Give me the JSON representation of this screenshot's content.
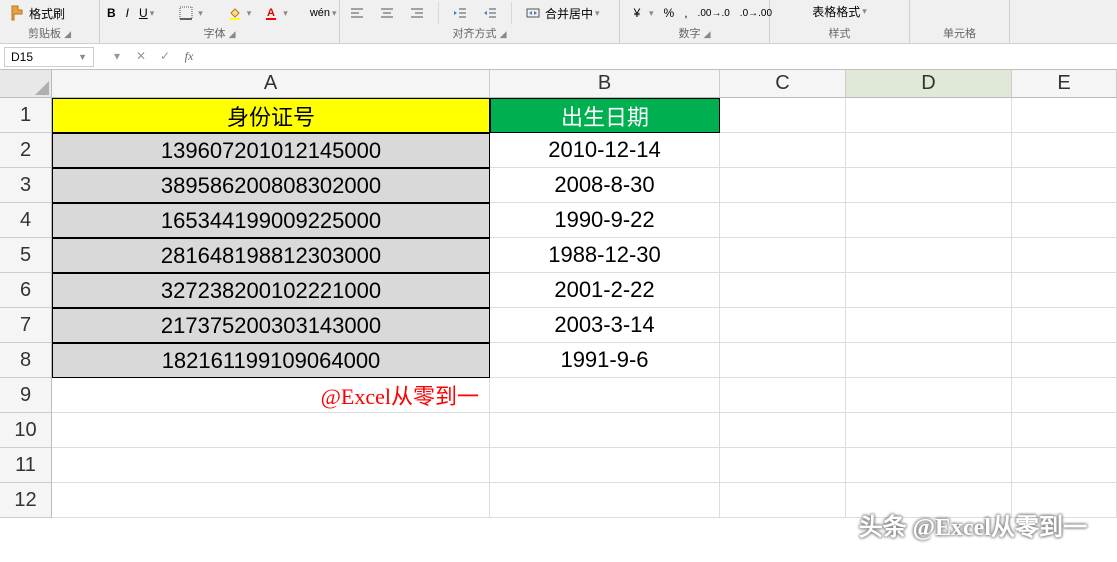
{
  "ribbon": {
    "groups": {
      "clipboard": {
        "label": "剪贴板",
        "format_painter": "格式刷"
      },
      "font": {
        "label": "字体",
        "bold": "B",
        "italic": "I",
        "underline": "U"
      },
      "align": {
        "label": "对齐方式",
        "merge_center": "合并居中"
      },
      "number": {
        "label": "数字"
      },
      "style": {
        "label": "样式",
        "table_format": "表格格式"
      },
      "cells": {
        "label": "单元格"
      }
    }
  },
  "name_box": "D15",
  "columns": [
    "A",
    "B",
    "C",
    "D",
    "E"
  ],
  "row_numbers": [
    1,
    2,
    3,
    4,
    5,
    6,
    7,
    8,
    9,
    10,
    11,
    12
  ],
  "headers": {
    "A": "身份证号",
    "B": "出生日期"
  },
  "rows": [
    {
      "id": "139607201012145000",
      "birth": "2010-12-14"
    },
    {
      "id": "389586200808302000",
      "birth": "2008-8-30"
    },
    {
      "id": "165344199009225000",
      "birth": "1990-9-22"
    },
    {
      "id": "281648198812303000",
      "birth": "1988-12-30"
    },
    {
      "id": "327238200102221000",
      "birth": "2001-2-22"
    },
    {
      "id": "217375200303143000",
      "birth": "2003-3-14"
    },
    {
      "id": "182161199109064000",
      "birth": "1991-9-6"
    }
  ],
  "attribution": "@Excel从零到一",
  "watermark": "头条 @Excel从零到一",
  "selected_cell": "D15"
}
